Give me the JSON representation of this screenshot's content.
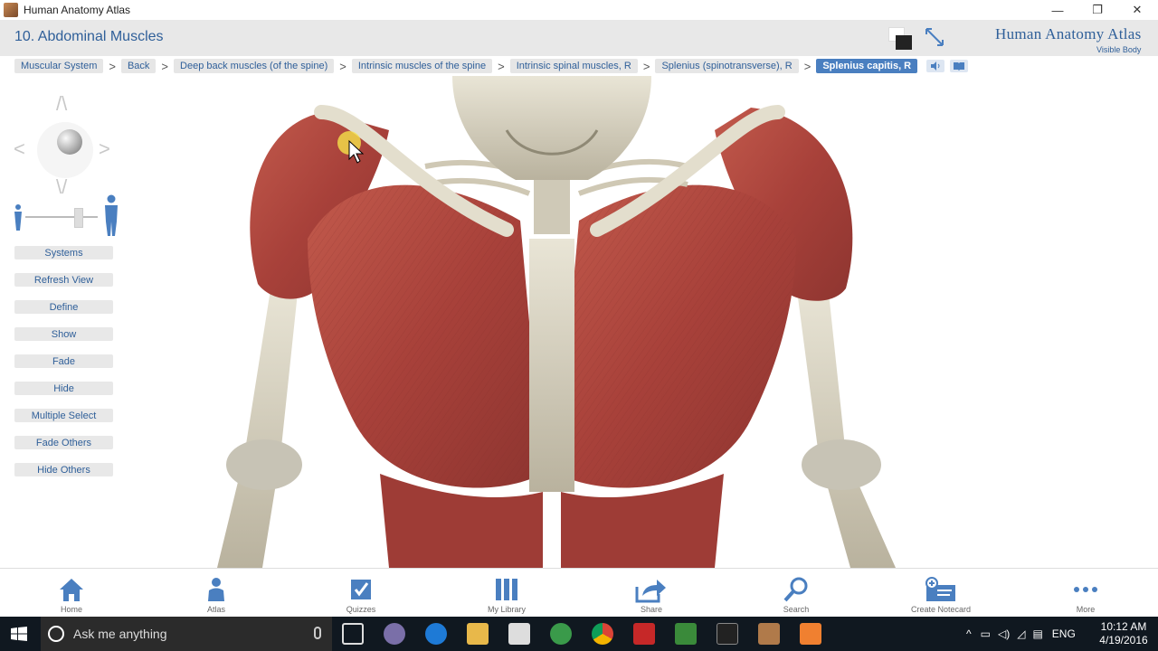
{
  "window": {
    "title": "Human Anatomy Atlas",
    "controls": [
      "—",
      "❐",
      "✕"
    ]
  },
  "header": {
    "page_title": "10. Abdominal Muscles",
    "brand_line1": "Human Anatomy Atlas",
    "brand_line2": "Visible Body"
  },
  "breadcrumb": {
    "items": [
      "Muscular System",
      "Back",
      "Deep back muscles (of the spine)",
      "Intrinsic muscles of the spine",
      "Intrinsic spinal muscles, R",
      "Splenius (spinotransverse), R",
      "Splenius capitis, R"
    ],
    "separator": ">"
  },
  "nav": {
    "up": "/\\",
    "down": "\\/",
    "left": "<",
    "right": ">"
  },
  "sidebar": {
    "buttons": [
      "Systems",
      "Refresh View",
      "Define",
      "Show",
      "Fade",
      "Hide",
      "Multiple Select",
      "Fade Others",
      "Hide Others"
    ]
  },
  "toolbar": {
    "items": [
      "Home",
      "Atlas",
      "Quizzes",
      "My Library",
      "Share",
      "Search",
      "Create Notecard",
      "More"
    ]
  },
  "taskbar": {
    "search_placeholder": "Ask me anything",
    "language": "ENG",
    "time": "10:12 AM",
    "date": "4/19/2016"
  },
  "colors": {
    "accent": "#4a7fc0",
    "title_blue": "#2f5f99",
    "muscle": "#b5483f",
    "bone": "#d9d4c3"
  }
}
